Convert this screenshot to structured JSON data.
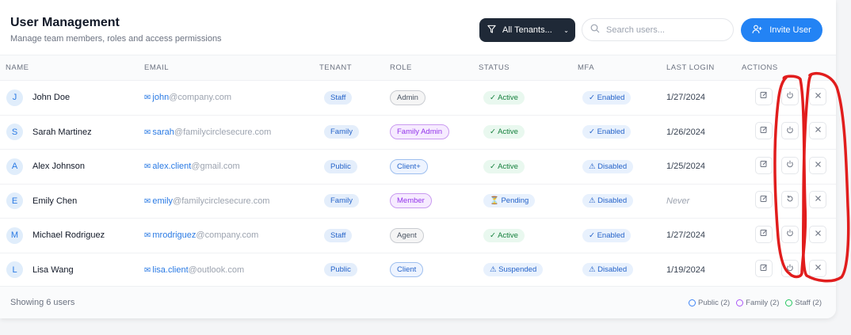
{
  "header": {
    "title": "User Management",
    "subtitle": "Manage team members, roles and access permissions",
    "filter_label": "All Tenants...",
    "search_placeholder": "Search users...",
    "invite_label": "Invite User"
  },
  "columns": [
    "NAME",
    "EMAIL",
    "TENANT",
    "ROLE",
    "STATUS",
    "MFA",
    "LAST LOGIN",
    "ACTIONS"
  ],
  "users": [
    {
      "initial": "J",
      "name": "John Doe",
      "email_local": "john",
      "email_domain": "@company.com",
      "tenant": "Staff",
      "role": "Admin",
      "role_style": "admin",
      "status": "✓ Active",
      "status_style": "active",
      "mfa": "✓ Enabled",
      "last_login": "1/27/2024",
      "toggle_icon": "power-icon"
    },
    {
      "initial": "S",
      "name": "Sarah Martinez",
      "email_local": "sarah",
      "email_domain": "@familycirclesecure.com",
      "tenant": "Family",
      "role": "Family Admin",
      "role_style": "family",
      "status": "✓ Active",
      "status_style": "active",
      "mfa": "✓ Enabled",
      "last_login": "1/26/2024",
      "toggle_icon": "power-icon"
    },
    {
      "initial": "A",
      "name": "Alex Johnson",
      "email_local": "alex.client",
      "email_domain": "@gmail.com",
      "tenant": "Public",
      "role": "Client+",
      "role_style": "client",
      "status": "✓ Active",
      "status_style": "active",
      "mfa": "⚠ Disabled",
      "last_login": "1/25/2024",
      "toggle_icon": "power-icon"
    },
    {
      "initial": "E",
      "name": "Emily Chen",
      "email_local": "emily",
      "email_domain": "@familycirclesecure.com",
      "tenant": "Family",
      "role": "Member",
      "role_style": "member",
      "status": "⏳ Pending",
      "status_style": "pending",
      "mfa": "⚠ Disabled",
      "last_login": "Never",
      "toggle_icon": "resend-icon"
    },
    {
      "initial": "M",
      "name": "Michael Rodriguez",
      "email_local": "mrodriguez",
      "email_domain": "@company.com",
      "tenant": "Staff",
      "role": "Agent",
      "role_style": "agent",
      "status": "✓ Active",
      "status_style": "active",
      "mfa": "✓ Enabled",
      "last_login": "1/27/2024",
      "toggle_icon": "power-icon"
    },
    {
      "initial": "L",
      "name": "Lisa Wang",
      "email_local": "lisa.client",
      "email_domain": "@outlook.com",
      "tenant": "Public",
      "role": "Client",
      "role_style": "client",
      "status": "⚠ Suspended",
      "status_style": "suspended",
      "mfa": "⚠ Disabled",
      "last_login": "1/19/2024",
      "toggle_icon": "power-icon"
    }
  ],
  "footer": {
    "showing": "Showing 6 users",
    "legend": [
      {
        "label": "Public (2)",
        "color": "#3b82f6"
      },
      {
        "label": "Family (2)",
        "color": "#a855f7"
      },
      {
        "label": "Staff (2)",
        "color": "#22c55e"
      }
    ]
  },
  "colors": {
    "accent": "#2383f4",
    "dark": "#1f2937",
    "annotation": "#e11d1d"
  }
}
